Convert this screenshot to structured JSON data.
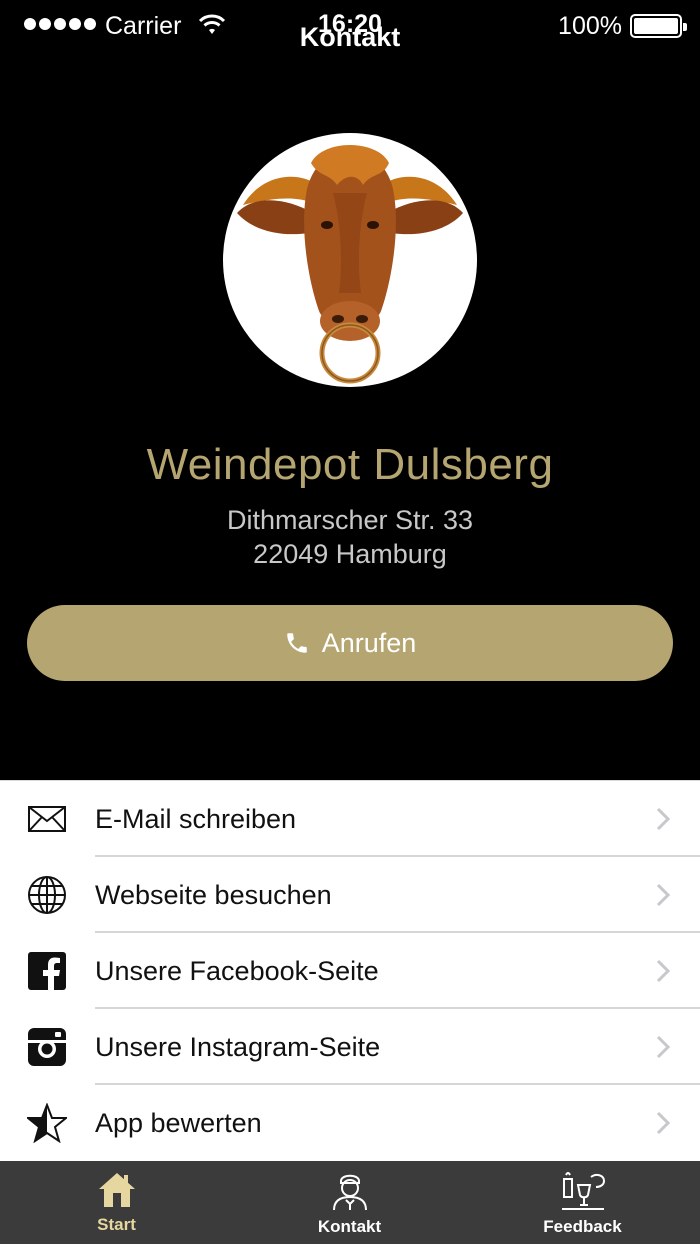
{
  "status_bar": {
    "carrier": "Carrier",
    "time": "16:20",
    "battery": "100%"
  },
  "nav": {
    "title": "Kontakt"
  },
  "business": {
    "name": "Weindepot Dulsberg",
    "street": "Dithmarscher Str. 33",
    "city": "22049 Hamburg"
  },
  "call_button": {
    "label": "Anrufen"
  },
  "list": [
    {
      "label": "E-Mail schreiben",
      "icon": "envelope-icon"
    },
    {
      "label": "Webseite besuchen",
      "icon": "globe-icon"
    },
    {
      "label": "Unsere Facebook-Seite",
      "icon": "facebook-icon"
    },
    {
      "label": "Unsere Instagram-Seite",
      "icon": "instagram-icon"
    },
    {
      "label": "App bewerten",
      "icon": "star-icon"
    }
  ],
  "tabs": [
    {
      "label": "Start",
      "icon": "home-icon",
      "active": true
    },
    {
      "label": "Kontakt",
      "icon": "person-icon",
      "active": false
    },
    {
      "label": "Feedback",
      "icon": "wine-feedback-icon",
      "active": false
    }
  ],
  "colors": {
    "accent": "#b5a570",
    "background": "#000000",
    "tab_bar": "#3b3b3b",
    "active_tab": "#e6d6a0"
  }
}
